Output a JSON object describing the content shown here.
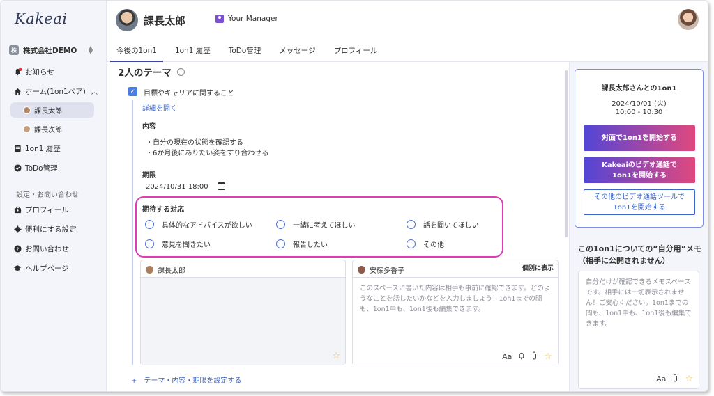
{
  "app": {
    "logo": "Kakeai"
  },
  "sidebar": {
    "company": {
      "badge": "株",
      "name": "株式会社DEMO"
    },
    "items": [
      {
        "label": "お知らせ"
      },
      {
        "label": "ホーム(1on1ペア)"
      },
      {
        "label": "課長太郎"
      },
      {
        "label": "課長次郎"
      },
      {
        "label": "1on1 履歴"
      },
      {
        "label": "ToDo管理"
      }
    ],
    "settings_section": "設定・お問い合わせ",
    "settings": [
      {
        "label": "プロフィール"
      },
      {
        "label": "便利にする設定"
      },
      {
        "label": "お問い合わせ"
      },
      {
        "label": "ヘルプページ"
      }
    ]
  },
  "header": {
    "user_name": "課長太郎",
    "role": "Your Manager",
    "tabs": [
      {
        "label": "今後の1on1"
      },
      {
        "label": "1on1 履歴"
      },
      {
        "label": "ToDo管理"
      },
      {
        "label": "メッセージ"
      },
      {
        "label": "プロフィール"
      }
    ]
  },
  "main": {
    "theme_title": "2人のテーマ",
    "info_icon": "i",
    "goal": "目標やキャリアに関すること",
    "detail_link": "詳細を開く",
    "content_label": "内容",
    "content_lines": [
      "・自分の現在の状態を確認する",
      "・6か月後にありたい姿をすり合わせる"
    ],
    "deadline_label": "期限",
    "deadline_value": "2024/10/31 18:00",
    "expect_label": "期待する対応",
    "options": [
      "具体的なアドバイスが欲しい",
      "一緒に考えてほしい",
      "話を聞いてほしい",
      "意見を聞きたい",
      "報告したい",
      "その他"
    ],
    "card_left": {
      "name": "課長太郎"
    },
    "card_right": {
      "name": "安藤多香子",
      "indiv": "個別に表示",
      "placeholder": "このスペースに書いた内容は相手も事前に確認できます。どのようなことを話したいかなどを入力しましょう！1on1までの間も、1on1中も、1on1後も編集できます。"
    },
    "add_link": "+　テーマ・内容・期限を設定する"
  },
  "right_panel": {
    "meeting_title": "課長太郎さんとの1on1",
    "date": "2024/10/01 (火)",
    "time": "10:00 - 10:30",
    "btn_face": "対面で1on1を開始する",
    "btn_video_1": "Kakeaiのビデオ通話で",
    "btn_video_2": "1on1を開始する",
    "btn_other_1": "その他のビデオ通話ツールで",
    "btn_other_2": "1on1を開始する",
    "memo_title_1": "この1on1についての“自分用”メモ",
    "memo_title_2": "（相手に公開されません）",
    "memo_placeholder": "自分だけが確認できるメモスペースです。相手には一切表示されません！ご安心ください。1on1までの間も、1on1中も、1on1後も編集できます。"
  },
  "tools": {
    "font": "Aa",
    "clip": "⌀",
    "bell": "🔔",
    "star": "☆"
  },
  "colors": {
    "accent": "#3b46a8",
    "highlight": "#e23ab4",
    "grad_start": "#5246d6",
    "grad_end": "#e0487e"
  }
}
